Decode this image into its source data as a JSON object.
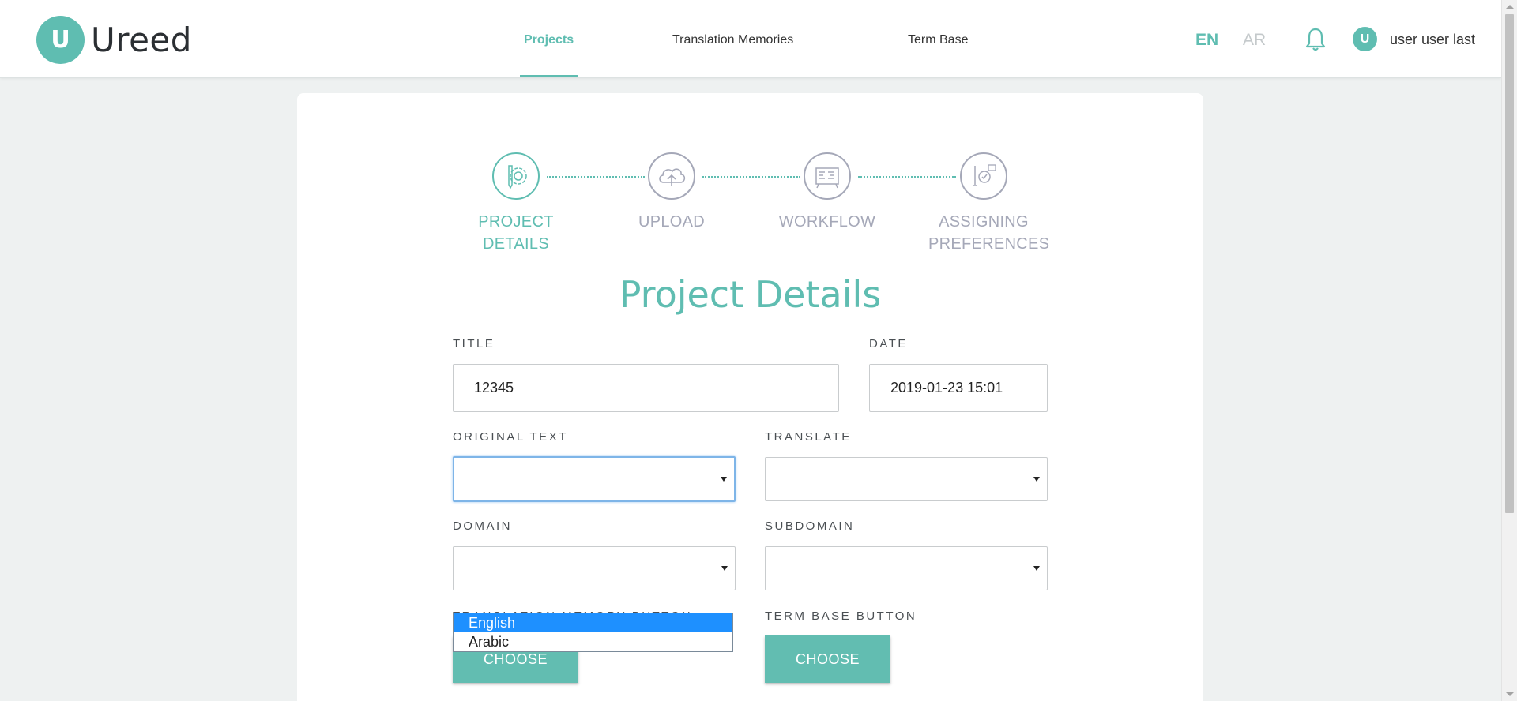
{
  "header": {
    "logo_text": "Ureed",
    "logo_mark": "U",
    "nav": [
      {
        "label": "Projects",
        "active": true
      },
      {
        "label": "Translation Memories",
        "active": false
      },
      {
        "label": "Term Base",
        "active": false
      }
    ],
    "lang_en": "EN",
    "lang_ar": "AR",
    "username": "user user last",
    "avatar_letter": "U"
  },
  "steps": [
    {
      "label": "PROJECT DETAILS",
      "icon": "gear-pencil-icon",
      "active": true
    },
    {
      "label": "UPLOAD",
      "icon": "cloud-upload-icon",
      "active": false
    },
    {
      "label": "WORKFLOW",
      "icon": "workflow-board-icon",
      "active": false
    },
    {
      "label": "ASSIGNING PREFERENCES",
      "icon": "preferences-icon",
      "active": false
    }
  ],
  "form": {
    "title": "Project Details",
    "title_label": "TITLE",
    "title_value": "12345",
    "date_label": "DATE",
    "date_value": "2019-01-23 15:01",
    "original_text_label": "ORIGINAL TEXT",
    "translate_label": "TRANSLATE",
    "domain_label": "DOMAIN",
    "subdomain_label": "SUBDOMAIN",
    "tm_button_label": "TRANSLATION MEMORY BUTTON",
    "tb_button_label": "TERM BASE BUTTON",
    "choose_label": "CHOOSE"
  },
  "dropdown": {
    "options": [
      {
        "label": "English",
        "selected": true
      },
      {
        "label": "Arabic",
        "selected": false
      }
    ]
  },
  "colors": {
    "accent": "#5fbdb1",
    "inactive": "#a5a8b8",
    "dropdown_highlight": "#1e90ff"
  }
}
